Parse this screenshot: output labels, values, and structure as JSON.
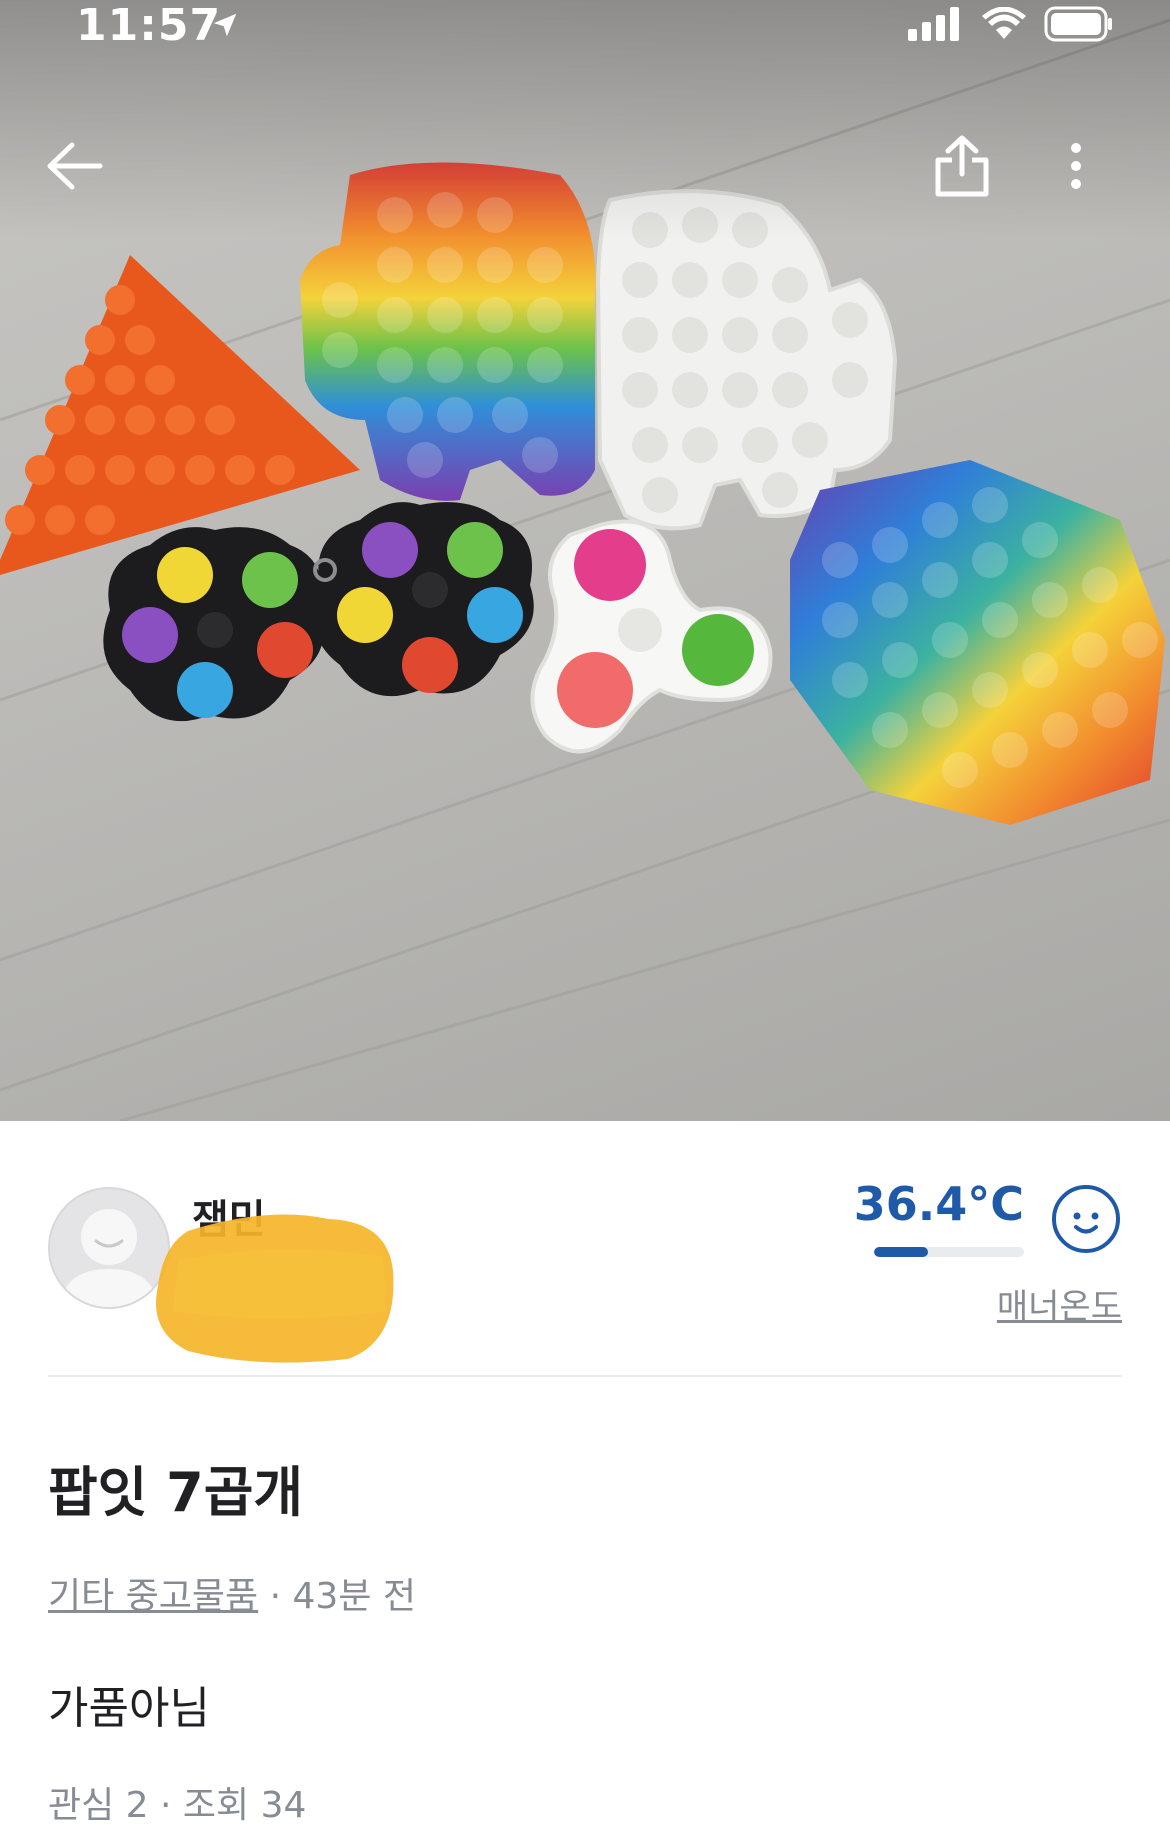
{
  "status_bar": {
    "time": "11:57"
  },
  "nav": {
    "back_icon": "arrow-left-icon",
    "share_icon": "share-icon",
    "more_icon": "more-vertical-icon"
  },
  "seller": {
    "name": "잼민",
    "manner_temperature": "36.4°C",
    "manner_level": 0.36,
    "manner_label": "매너온도"
  },
  "article": {
    "title": "팝잇 7곱개",
    "category": "기타 중고물품",
    "time_ago": "· 43분 전",
    "description": "가품아님",
    "stats": "관심 2 · 조회 34"
  },
  "colors": {
    "text_primary": "#212124",
    "text_secondary": "#868b94",
    "temperature_blue": "#1f5aa9",
    "redaction": "#f5b52a"
  }
}
